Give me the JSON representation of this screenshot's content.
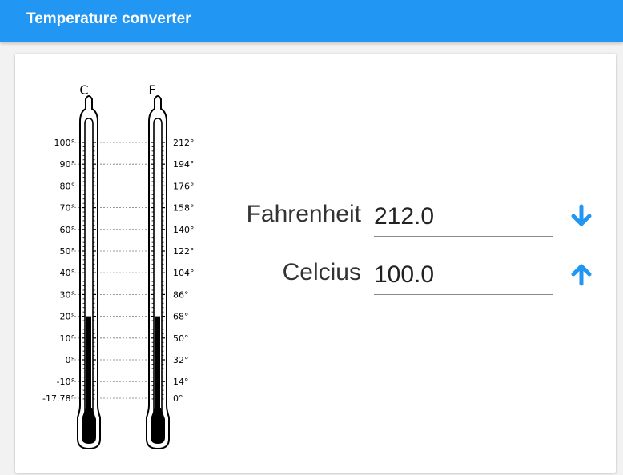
{
  "app_bar": {
    "title": "Temperature converter"
  },
  "thermometer": {
    "celsius_heading": "C",
    "fahrenheit_heading": "F",
    "celsius_ticks": [
      "100°",
      "90°",
      "80°",
      "70°",
      "60°",
      "50°",
      "40°",
      "30°",
      "20°",
      "10°",
      "0°",
      "-10°",
      "-17.78°"
    ],
    "fahrenheit_ticks": [
      "212°",
      "194°",
      "176°",
      "158°",
      "140°",
      "122°",
      "104°",
      "86°",
      "68°",
      "50°",
      "32°",
      "14°",
      "0°"
    ],
    "current_reading_celsius": 20
  },
  "form": {
    "fahrenheit_label": "Fahrenheit",
    "fahrenheit_value": "212.0",
    "celsius_label": "Celcius",
    "celsius_value": "100.0"
  },
  "icons": {
    "convert_down": "arrow-down-icon",
    "convert_up": "arrow-up-icon"
  },
  "colors": {
    "accent": "#2196f3",
    "field_underline": "#8a8a8a"
  }
}
